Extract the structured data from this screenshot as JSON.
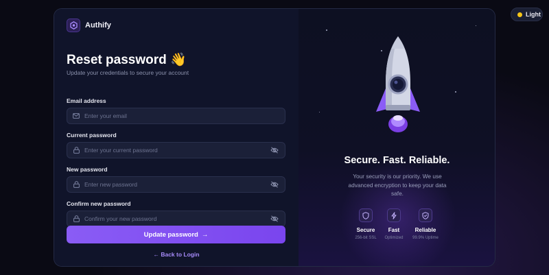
{
  "theme_toggle": {
    "label": "Light",
    "icon": "sun-dot-icon",
    "dot_color": "#f5c518"
  },
  "brand": {
    "name": "Authify",
    "logo_icon": "hexagon-logo-icon"
  },
  "form": {
    "title": "Reset password 👋",
    "subtitle": "Update your credentials to secure your account",
    "fields": [
      {
        "label": "Email address",
        "placeholder": "Enter your email",
        "value": "",
        "lead_icon": "mail-icon",
        "toggle_icon": ""
      },
      {
        "label": "Current password",
        "placeholder": "Enter your current password",
        "value": "",
        "lead_icon": "lock-icon",
        "toggle_icon": "eye-off-icon"
      },
      {
        "label": "New password",
        "placeholder": "Enter new password",
        "value": "",
        "lead_icon": "lock-icon",
        "toggle_icon": "eye-off-icon"
      },
      {
        "label": "Confirm new password",
        "placeholder": "Confirm your new password",
        "value": "",
        "lead_icon": "lock-icon",
        "toggle_icon": "eye-off-icon"
      }
    ],
    "submit_label": "Update password",
    "submit_arrow": "→",
    "back_link": "← Back to Login"
  },
  "hero": {
    "tagline": "Secure. Fast. Reliable.",
    "description": "Your security is our priority. We use advanced encryption to keep your data safe.",
    "features": [
      {
        "icon": "shield-icon",
        "title": "Secure",
        "subtitle": "256-bit SSL"
      },
      {
        "icon": "lightning-icon",
        "title": "Fast",
        "subtitle": "Optimized"
      },
      {
        "icon": "shield-check-icon",
        "title": "Reliable",
        "subtitle": "99.9% Uptime"
      }
    ]
  },
  "colors": {
    "accent": "#8a5cf5",
    "link": "#a78bfa",
    "panel_left": "#10142a",
    "input_bg": "#1b2038"
  }
}
